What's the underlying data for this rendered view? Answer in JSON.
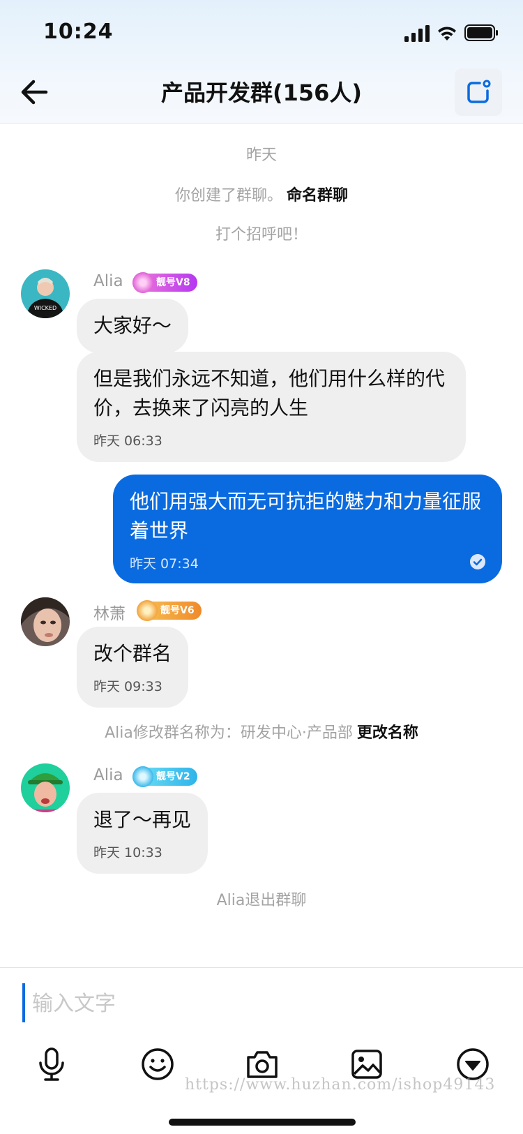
{
  "status_bar": {
    "time": "10:24"
  },
  "header": {
    "title": "产品开发群(156人)"
  },
  "messages_area": {
    "date_label": "昨天",
    "created_notice": {
      "text": "你创建了群聊。",
      "link": "命名群聊"
    },
    "greeting": "打个招呼吧！",
    "msg1": {
      "sender": "Alia",
      "badge": "靓号V8",
      "bubble1_text": "大家好～",
      "bubble2_text": "但是我们永远不知道，他们用什么样的代价，去换来了闪亮的人生",
      "bubble2_time": "昨天 06:33"
    },
    "mine": {
      "text": "他们用强大而无可抗拒的魅力和力量征服着世界",
      "time": "昨天 07:34"
    },
    "msg2": {
      "sender": "林萧",
      "badge": "靓号V6",
      "text": "改个群名",
      "time": "昨天 09:33"
    },
    "rename_notice": {
      "text": "Alia修改群名称为：研发中心·产品部",
      "link": "更改名称"
    },
    "msg3": {
      "sender": "Alia",
      "badge": "靓号V2",
      "text": "退了～再见",
      "time": "昨天 10:33"
    },
    "exit_notice": "Alia退出群聊"
  },
  "composer": {
    "placeholder": "输入文字"
  },
  "toolbar_icons": [
    "mic-icon",
    "emoji-icon",
    "camera-icon",
    "image-icon",
    "chevron-down-circle-icon"
  ],
  "watermark": "https://www.huzhan.com/ishop49143",
  "colors": {
    "accent": "#0a6be0",
    "bubble": "#efefef",
    "badge_v8": "#c13cf0",
    "badge_v6": "#f3a23a",
    "badge_v2": "#3cc8f0"
  }
}
